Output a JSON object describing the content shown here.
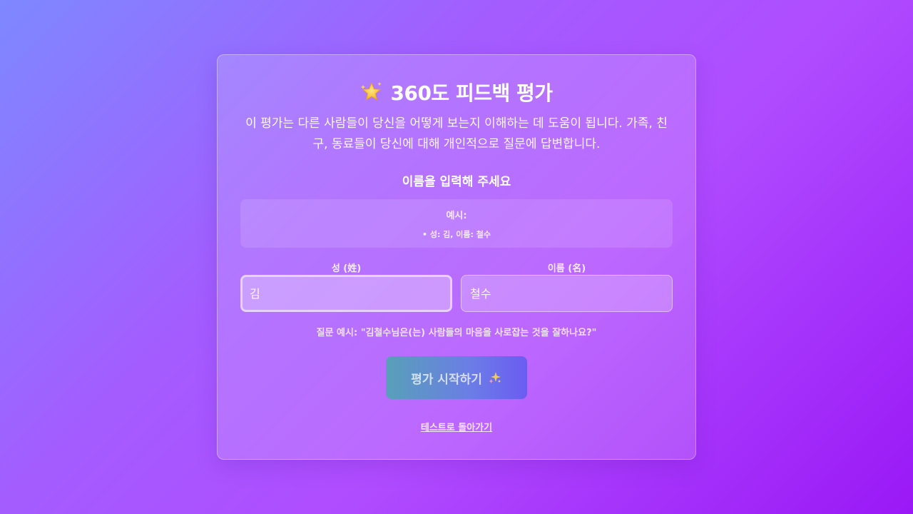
{
  "header": {
    "title_icon": "star-icon",
    "title": "360도 피드백 평가",
    "description": "이 평가는 다른 사람들이 당신을 어떻게 보는지 이해하는 데 도움이 됩니다. 가족, 친구, 동료들이 당신에 대해 개인적으로 질문에 답변합니다."
  },
  "form": {
    "heading": "이름을 입력해 주세요",
    "example_label": "예시:",
    "example_item": "• 성: 김, 이름: 철수",
    "last_name_label": "성 (姓)",
    "last_name_placeholder": "김",
    "first_name_label": "이름 (名)",
    "first_name_placeholder": "철수",
    "question_example": "질문 예시: \"김철수님은(는) 사람들의 마음을 사로잡는 것을 잘하나요?\"",
    "start_button": "평가 시작하기",
    "start_button_icon": "sparkle-icon",
    "back_link": "테스트로 돌아가기"
  },
  "colors": {
    "background_start": "#7e88ff",
    "background_end": "#9a18f6",
    "button_start": "#58a0b8",
    "button_end": "#6b5cf2"
  }
}
